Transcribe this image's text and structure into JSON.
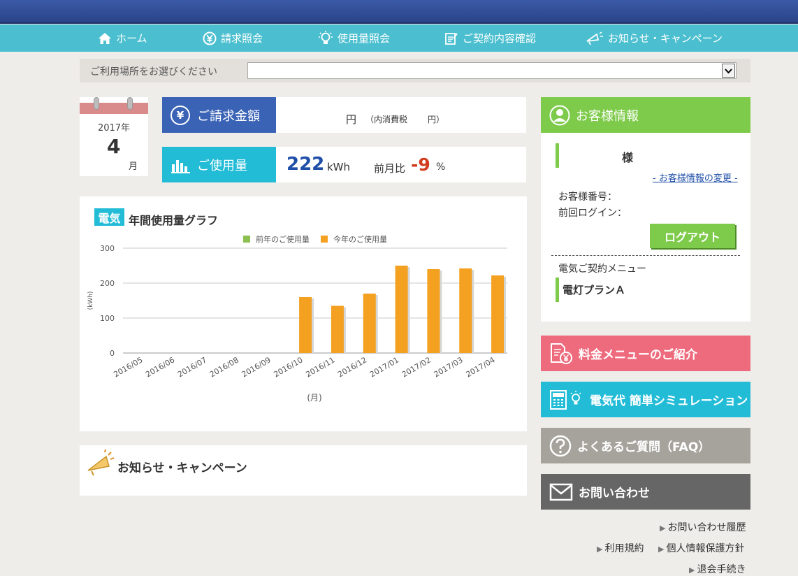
{
  "nav": {
    "items": [
      {
        "label": "ホーム",
        "icon": "home-icon"
      },
      {
        "label": "請求照会",
        "icon": "yen-icon"
      },
      {
        "label": "使用量照会",
        "icon": "bulb-icon"
      },
      {
        "label": "ご契約内容確認",
        "icon": "document-icon"
      },
      {
        "label": "お知らせ・キャンペーン",
        "icon": "megaphone-icon"
      }
    ]
  },
  "location": {
    "label": "ご利用場所をお選びください",
    "selected": ""
  },
  "calendar": {
    "year": "2017年",
    "month": "4",
    "month_unit": "月"
  },
  "billing": {
    "title": "ご請求金額",
    "yen": "円",
    "tax_label": "（内消費税",
    "tax_yen": "円）"
  },
  "usage": {
    "title": "ご使用量",
    "value": "222",
    "unit": "kWh",
    "compare_label": "前月比",
    "compare_value": "-9",
    "compare_unit": "%"
  },
  "graph": {
    "badge": "電気",
    "title": "年間使用量グラフ"
  },
  "chart_data": {
    "type": "bar",
    "categories": [
      "2016/05",
      "2016/06",
      "2016/07",
      "2016/08",
      "2016/09",
      "2016/10",
      "2016/11",
      "2016/12",
      "2017/01",
      "2017/02",
      "2017/03",
      "2017/04"
    ],
    "series": [
      {
        "name": "前年のご使用量",
        "values": [
          null,
          null,
          null,
          null,
          null,
          null,
          null,
          null,
          null,
          null,
          null,
          null
        ],
        "color": "#8cc152"
      },
      {
        "name": "今年のご使用量",
        "values": [
          null,
          null,
          null,
          null,
          null,
          160,
          135,
          170,
          250,
          240,
          242,
          222
        ],
        "color": "#f4a020"
      }
    ],
    "ylabel": "(kWh)",
    "xlabel": "(月)",
    "ylim": [
      0,
      300
    ],
    "yticks": [
      0,
      100,
      200,
      300
    ],
    "legend": "top"
  },
  "news": {
    "title": "お知らせ・キャンペーン"
  },
  "customer": {
    "title": "お客様情報",
    "name_suffix": "様",
    "change_link": "- お客様情報の変更 -",
    "number_label": "お客様番号：",
    "last_login_label": "前回ログイン：",
    "logout_label": "ログアウト",
    "contract_menu_label": "電気ご契約メニュー",
    "plan": "電灯プランＡ"
  },
  "side_buttons": [
    {
      "label": "料金メニューのご紹介",
      "color": "#ee6a7d"
    },
    {
      "label": "電気代 簡単シミュレーション",
      "color": "#22bcd7"
    },
    {
      "label": "よくあるご質問（FAQ）",
      "color": "#a6a39d"
    },
    {
      "label": "お問い合わせ",
      "color": "#666666"
    }
  ],
  "footer_links": {
    "history": "お問い合わせ履歴",
    "terms": "利用規約",
    "privacy": "個人情報保護方針",
    "withdraw": "退会手続き"
  }
}
